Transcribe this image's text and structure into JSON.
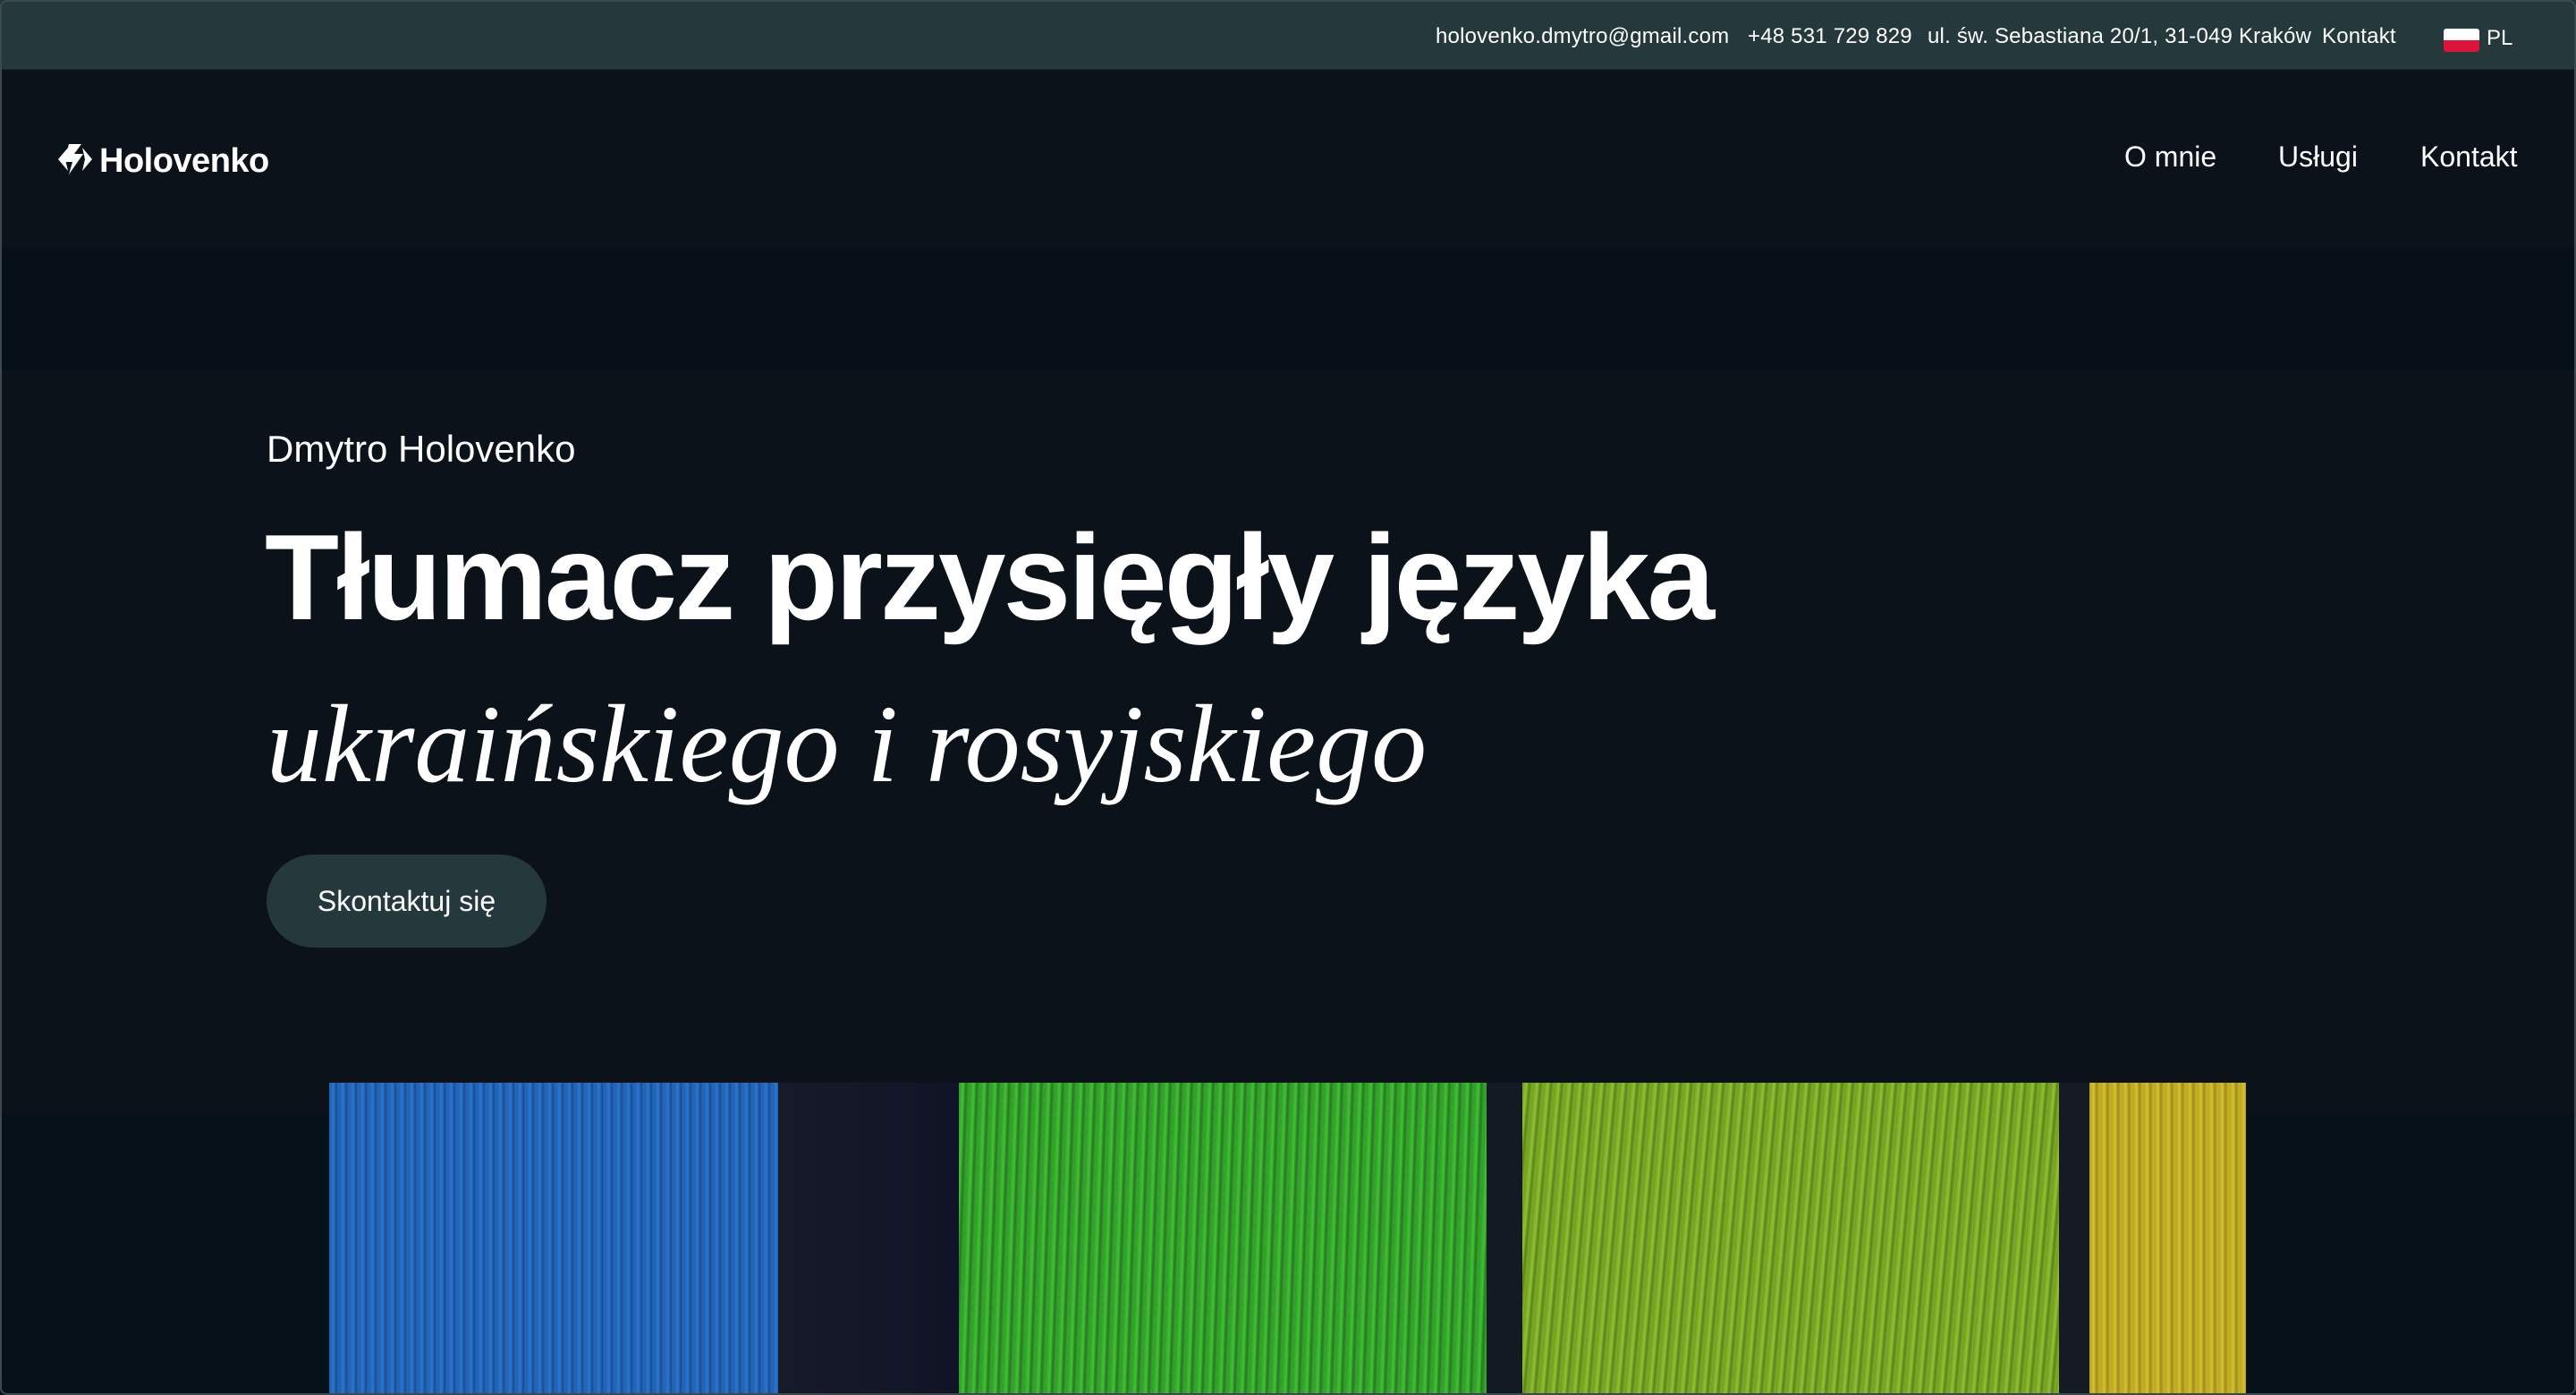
{
  "topbar": {
    "email": "holovenko.dmytro@gmail.com",
    "phone": "+48 531 729 829",
    "address": "ul. św. Sebastiana 20/1, 31-049 Kraków",
    "contact_link": "Kontakt",
    "language": "PL",
    "flag_icon": "poland-flag-icon"
  },
  "header": {
    "logo_text": "Holovenko",
    "logo_icon": "holovenko-logo-icon",
    "nav": [
      {
        "label": "O mnie"
      },
      {
        "label": "Usługi"
      },
      {
        "label": "Kontakt"
      }
    ]
  },
  "hero": {
    "eyebrow": "Dmytro Holovenko",
    "headline": "Tłumacz przysięgły języka",
    "subheadline": "ukraińskiego i rosyjskiego",
    "cta_label": "Skontaktuj się"
  },
  "colors": {
    "background": "#0b121a",
    "topbar": "#25383c",
    "button": "#25383c",
    "text": "#ffffff"
  }
}
